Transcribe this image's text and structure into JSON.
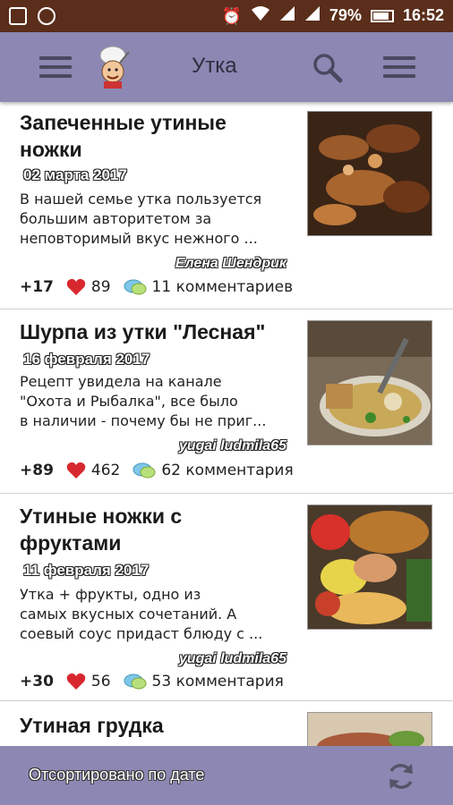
{
  "status_bar": {
    "battery": "79%",
    "time": "16:52"
  },
  "app_bar": {
    "title": "Утка"
  },
  "recipes": [
    {
      "title_line1": "Запеченные утиные",
      "title_line2": "ножки",
      "date": "02 марта 2017",
      "desc_line1": "В нашей семье утка пользуется",
      "desc_line2": "большим авторитетом за",
      "desc_line3": "неповторимый вкус нежного ...",
      "author": "Елена Шендрик",
      "score": "+17",
      "likes": "89",
      "comments": "11 комментариев"
    },
    {
      "title_line1": "Шурпа из утки \"Лесная\"",
      "title_line2": "",
      "date": "16 февраля 2017",
      "desc_line1": "Рецепт увидела на канале",
      "desc_line2": "\"Охота и Рыбалка\", все было",
      "desc_line3": "в наличии - почему бы не приг...",
      "author": "yugai ludmila65",
      "score": "+89",
      "likes": "462",
      "comments": "62 комментария"
    },
    {
      "title_line1": "Утиные ножки с",
      "title_line2": "фруктами",
      "date": "11 февраля 2017",
      "desc_line1": "Утка + фрукты, одно из",
      "desc_line2": "самых вкусных сочетаний. А",
      "desc_line3": "соевый соус придаст блюду с ...",
      "author": "yugai ludmila65",
      "score": "+30",
      "likes": "56",
      "comments": "53 комментария"
    },
    {
      "title_line1": "Утиная грудка",
      "title_line2": ""
    }
  ],
  "bottom_bar": {
    "sort_label": "Отсортировано по дате"
  },
  "colors": {
    "app_bar": "#8c88b3",
    "status_bar": "#5a2e1a",
    "heart": "#d8282f",
    "bubble": "#7fc7e8"
  }
}
